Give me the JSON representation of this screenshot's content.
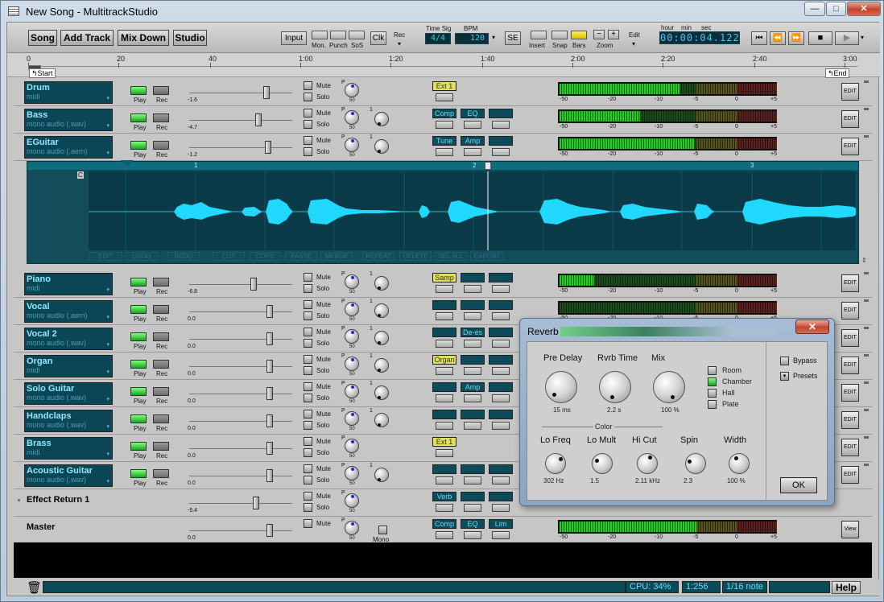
{
  "window": {
    "title": "New Song - MultitrackStudio",
    "minimize": "—",
    "maximize": "□",
    "close": "✕"
  },
  "toolbar": {
    "song": "Song",
    "add_track": "Add Track",
    "mix_down": "Mix Down",
    "studio": "Studio",
    "input": "Input",
    "mon": "Mon.",
    "punch": "Punch",
    "sos": "SoS",
    "clk": "Clk",
    "rec": "Rec",
    "timesig_label": "Time Sig",
    "timesig": "4/4",
    "bpm_label": "BPM",
    "bpm": "120",
    "se": "SE",
    "insert": "Insert",
    "snap": "Snap",
    "bars": "Bars",
    "zoom": "Zoom",
    "edit": "Edit",
    "zoom_minus": "−",
    "zoom_plus": "+",
    "hour": "hour",
    "min": "min",
    "sec": "sec",
    "time": "00:00:04.122"
  },
  "transport": {
    "to_start": "⏮",
    "rewind": "⏪",
    "forward": "⏩",
    "stop": "■",
    "play": "▶"
  },
  "ruler": {
    "ticks": [
      "0",
      "20",
      "40",
      "1:00",
      "1:20",
      "1:40",
      "2:00",
      "2:20",
      "2:40",
      "3:00"
    ],
    "start": "Start",
    "end": "End"
  },
  "labels": {
    "play": "Play",
    "rec": "Rec",
    "mute": "Mute",
    "solo": "Solo",
    "pan": "P",
    "vol": "1",
    "pan_val": "50",
    "edit": "EDIT",
    "view": "View",
    "mono": "Mono"
  },
  "meter_scale": [
    "-50",
    "-20",
    "-10",
    "-5",
    "0",
    "+5"
  ],
  "tracks": [
    {
      "name": "Drum",
      "source": "midi",
      "gain": "-1.6",
      "fx": [
        "Ext 1"
      ],
      "level": 0.55
    },
    {
      "name": "Bass",
      "source": "mono audio (.wav)",
      "gain": "-4.7",
      "fx": [
        "Comp",
        "EQ",
        ""
      ],
      "level": 0.37
    },
    {
      "name": "EGuitar",
      "source": "mono audio (.aem)",
      "gain": "-1.2",
      "fx": [
        "Tune",
        "Amp",
        ""
      ],
      "level": 0.62
    },
    {
      "name": "Piano",
      "source": "midi",
      "gain": "-6.8",
      "fx": [
        "Samp",
        "",
        ""
      ],
      "level": 0.16
    },
    {
      "name": "Vocal",
      "source": "mono audio (.aem)",
      "gain": "0.0",
      "fx": [
        "",
        "",
        ""
      ],
      "level": 0.0
    },
    {
      "name": "Vocal 2",
      "source": "mono audio (.wav)",
      "gain": "0.0",
      "fx": [
        "",
        "De-es",
        ""
      ],
      "level": 0.0
    },
    {
      "name": "Organ",
      "source": "midi",
      "gain": "0.0",
      "fx": [
        "Organ",
        "",
        ""
      ],
      "level": 0.0
    },
    {
      "name": "Solo Guitar",
      "source": "mono audio (.wav)",
      "gain": "0.0",
      "fx": [
        "",
        "Amp",
        ""
      ],
      "level": 0.0
    },
    {
      "name": "Handclaps",
      "source": "mono audio (.wav)",
      "gain": "0.0",
      "fx": [
        "",
        "",
        ""
      ],
      "level": 0.0
    },
    {
      "name": "Brass",
      "source": "midi",
      "gain": "0.0",
      "fx": [
        "Ext 1"
      ],
      "level": 0.0
    },
    {
      "name": "Acoustic Guitar",
      "source": "mono audio (.wav)",
      "gain": "0.0",
      "fx": [
        "",
        "",
        ""
      ],
      "level": 0.0
    }
  ],
  "effect_return": {
    "name": "Effect Return 1",
    "gain": "-5.4",
    "fx": [
      "Verb",
      "",
      ""
    ]
  },
  "master": {
    "name": "Master",
    "gain": "0.0",
    "fx": [
      "Comp",
      "EQ",
      "Lim"
    ],
    "level": 0.68
  },
  "editor": {
    "markers": [
      "1",
      "2",
      "3"
    ],
    "tools": [
      "EDIT",
      "UNDO",
      "REDO",
      "CUT",
      "COPY",
      "PASTE",
      "MERGE",
      "REPEAT",
      "DELETE",
      "SEL ALL",
      "EXPORT"
    ]
  },
  "status": {
    "cpu": "CPU: 34%",
    "position": "1:256",
    "snap": "1/16 note",
    "help": "Help"
  },
  "reverb": {
    "title": "Reverb",
    "close": "✕",
    "knobs_top": [
      {
        "label": "Pre Delay",
        "value": "15 ms"
      },
      {
        "label": "Rvrb Time",
        "value": "2.2 s"
      },
      {
        "label": "Mix",
        "value": "100 %"
      }
    ],
    "rooms": [
      "Room",
      "Chamber",
      "Hall",
      "Plate"
    ],
    "selected_room": "Chamber",
    "color_label": "Color",
    "knobs_bottom": [
      {
        "label": "Lo Freq",
        "value": "302 Hz"
      },
      {
        "label": "Lo Mult",
        "value": "1.5"
      },
      {
        "label": "Hi Cut",
        "value": "2.11 kHz"
      },
      {
        "label": "Spin",
        "value": "2.3"
      },
      {
        "label": "Width",
        "value": "100 %"
      }
    ],
    "bypass": "Bypass",
    "presets": "Presets",
    "ok": "OK"
  }
}
